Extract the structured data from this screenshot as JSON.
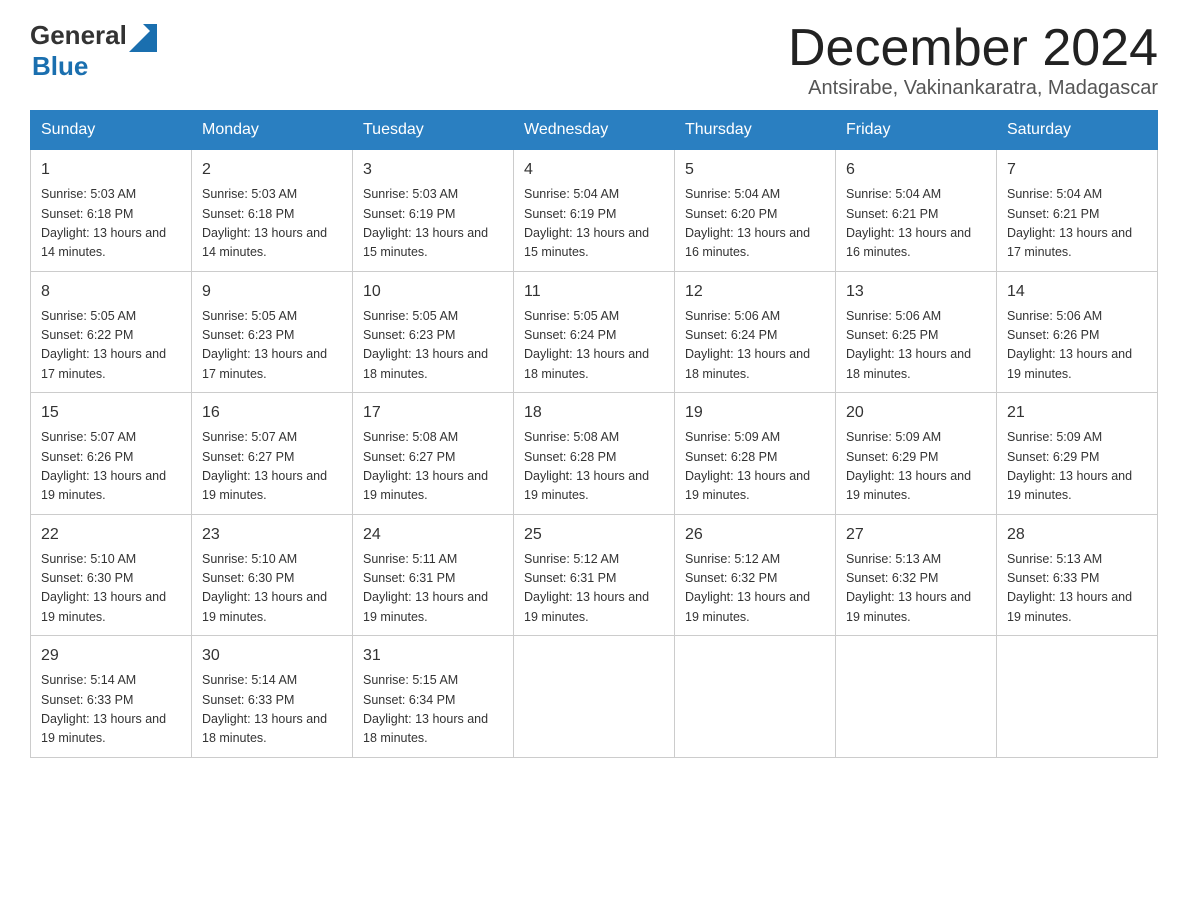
{
  "logo": {
    "general": "General",
    "blue": "Blue"
  },
  "header": {
    "month_year": "December 2024",
    "location": "Antsirabe, Vakinankaratra, Madagascar"
  },
  "weekdays": [
    "Sunday",
    "Monday",
    "Tuesday",
    "Wednesday",
    "Thursday",
    "Friday",
    "Saturday"
  ],
  "weeks": [
    [
      {
        "day": "1",
        "sunrise": "Sunrise: 5:03 AM",
        "sunset": "Sunset: 6:18 PM",
        "daylight": "Daylight: 13 hours and 14 minutes."
      },
      {
        "day": "2",
        "sunrise": "Sunrise: 5:03 AM",
        "sunset": "Sunset: 6:18 PM",
        "daylight": "Daylight: 13 hours and 14 minutes."
      },
      {
        "day": "3",
        "sunrise": "Sunrise: 5:03 AM",
        "sunset": "Sunset: 6:19 PM",
        "daylight": "Daylight: 13 hours and 15 minutes."
      },
      {
        "day": "4",
        "sunrise": "Sunrise: 5:04 AM",
        "sunset": "Sunset: 6:19 PM",
        "daylight": "Daylight: 13 hours and 15 minutes."
      },
      {
        "day": "5",
        "sunrise": "Sunrise: 5:04 AM",
        "sunset": "Sunset: 6:20 PM",
        "daylight": "Daylight: 13 hours and 16 minutes."
      },
      {
        "day": "6",
        "sunrise": "Sunrise: 5:04 AM",
        "sunset": "Sunset: 6:21 PM",
        "daylight": "Daylight: 13 hours and 16 minutes."
      },
      {
        "day": "7",
        "sunrise": "Sunrise: 5:04 AM",
        "sunset": "Sunset: 6:21 PM",
        "daylight": "Daylight: 13 hours and 17 minutes."
      }
    ],
    [
      {
        "day": "8",
        "sunrise": "Sunrise: 5:05 AM",
        "sunset": "Sunset: 6:22 PM",
        "daylight": "Daylight: 13 hours and 17 minutes."
      },
      {
        "day": "9",
        "sunrise": "Sunrise: 5:05 AM",
        "sunset": "Sunset: 6:23 PM",
        "daylight": "Daylight: 13 hours and 17 minutes."
      },
      {
        "day": "10",
        "sunrise": "Sunrise: 5:05 AM",
        "sunset": "Sunset: 6:23 PM",
        "daylight": "Daylight: 13 hours and 18 minutes."
      },
      {
        "day": "11",
        "sunrise": "Sunrise: 5:05 AM",
        "sunset": "Sunset: 6:24 PM",
        "daylight": "Daylight: 13 hours and 18 minutes."
      },
      {
        "day": "12",
        "sunrise": "Sunrise: 5:06 AM",
        "sunset": "Sunset: 6:24 PM",
        "daylight": "Daylight: 13 hours and 18 minutes."
      },
      {
        "day": "13",
        "sunrise": "Sunrise: 5:06 AM",
        "sunset": "Sunset: 6:25 PM",
        "daylight": "Daylight: 13 hours and 18 minutes."
      },
      {
        "day": "14",
        "sunrise": "Sunrise: 5:06 AM",
        "sunset": "Sunset: 6:26 PM",
        "daylight": "Daylight: 13 hours and 19 minutes."
      }
    ],
    [
      {
        "day": "15",
        "sunrise": "Sunrise: 5:07 AM",
        "sunset": "Sunset: 6:26 PM",
        "daylight": "Daylight: 13 hours and 19 minutes."
      },
      {
        "day": "16",
        "sunrise": "Sunrise: 5:07 AM",
        "sunset": "Sunset: 6:27 PM",
        "daylight": "Daylight: 13 hours and 19 minutes."
      },
      {
        "day": "17",
        "sunrise": "Sunrise: 5:08 AM",
        "sunset": "Sunset: 6:27 PM",
        "daylight": "Daylight: 13 hours and 19 minutes."
      },
      {
        "day": "18",
        "sunrise": "Sunrise: 5:08 AM",
        "sunset": "Sunset: 6:28 PM",
        "daylight": "Daylight: 13 hours and 19 minutes."
      },
      {
        "day": "19",
        "sunrise": "Sunrise: 5:09 AM",
        "sunset": "Sunset: 6:28 PM",
        "daylight": "Daylight: 13 hours and 19 minutes."
      },
      {
        "day": "20",
        "sunrise": "Sunrise: 5:09 AM",
        "sunset": "Sunset: 6:29 PM",
        "daylight": "Daylight: 13 hours and 19 minutes."
      },
      {
        "day": "21",
        "sunrise": "Sunrise: 5:09 AM",
        "sunset": "Sunset: 6:29 PM",
        "daylight": "Daylight: 13 hours and 19 minutes."
      }
    ],
    [
      {
        "day": "22",
        "sunrise": "Sunrise: 5:10 AM",
        "sunset": "Sunset: 6:30 PM",
        "daylight": "Daylight: 13 hours and 19 minutes."
      },
      {
        "day": "23",
        "sunrise": "Sunrise: 5:10 AM",
        "sunset": "Sunset: 6:30 PM",
        "daylight": "Daylight: 13 hours and 19 minutes."
      },
      {
        "day": "24",
        "sunrise": "Sunrise: 5:11 AM",
        "sunset": "Sunset: 6:31 PM",
        "daylight": "Daylight: 13 hours and 19 minutes."
      },
      {
        "day": "25",
        "sunrise": "Sunrise: 5:12 AM",
        "sunset": "Sunset: 6:31 PM",
        "daylight": "Daylight: 13 hours and 19 minutes."
      },
      {
        "day": "26",
        "sunrise": "Sunrise: 5:12 AM",
        "sunset": "Sunset: 6:32 PM",
        "daylight": "Daylight: 13 hours and 19 minutes."
      },
      {
        "day": "27",
        "sunrise": "Sunrise: 5:13 AM",
        "sunset": "Sunset: 6:32 PM",
        "daylight": "Daylight: 13 hours and 19 minutes."
      },
      {
        "day": "28",
        "sunrise": "Sunrise: 5:13 AM",
        "sunset": "Sunset: 6:33 PM",
        "daylight": "Daylight: 13 hours and 19 minutes."
      }
    ],
    [
      {
        "day": "29",
        "sunrise": "Sunrise: 5:14 AM",
        "sunset": "Sunset: 6:33 PM",
        "daylight": "Daylight: 13 hours and 19 minutes."
      },
      {
        "day": "30",
        "sunrise": "Sunrise: 5:14 AM",
        "sunset": "Sunset: 6:33 PM",
        "daylight": "Daylight: 13 hours and 18 minutes."
      },
      {
        "day": "31",
        "sunrise": "Sunrise: 5:15 AM",
        "sunset": "Sunset: 6:34 PM",
        "daylight": "Daylight: 13 hours and 18 minutes."
      },
      null,
      null,
      null,
      null
    ]
  ]
}
